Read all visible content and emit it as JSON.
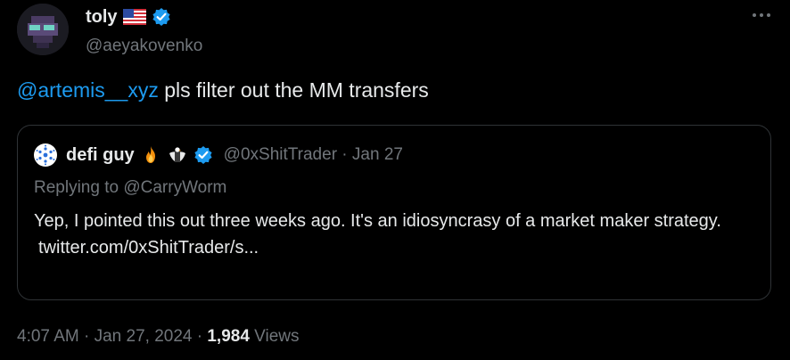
{
  "author": {
    "display_name": "toly",
    "flag_icon": "us-flag-icon",
    "handle": "@aeyakovenko",
    "verified_color": "#1d9bf0"
  },
  "tweet": {
    "mention": "@artemis__xyz",
    "text": " pls filter out the MM transfers"
  },
  "quote": {
    "display_name": "defi guy",
    "emojis": [
      "fire-emoji",
      "eagle-emoji"
    ],
    "handle_date": "@0xShitTrader · Jan 27",
    "replying": "Replying to @CarryWorm",
    "text": "Yep, I pointed this out three weeks ago. It's an idiosyncrasy of a market maker strategy.",
    "link": "twitter.com/0xShitTrader/s..."
  },
  "meta": {
    "time": "4:07 AM · Jan 27, 2024 · ",
    "views_count": "1,984",
    "views_label": " Views"
  },
  "colors": {
    "background": "#000000",
    "text": "#e7e9ea",
    "muted": "#71767b",
    "accent": "#1d9bf0",
    "border": "#2f3336"
  }
}
